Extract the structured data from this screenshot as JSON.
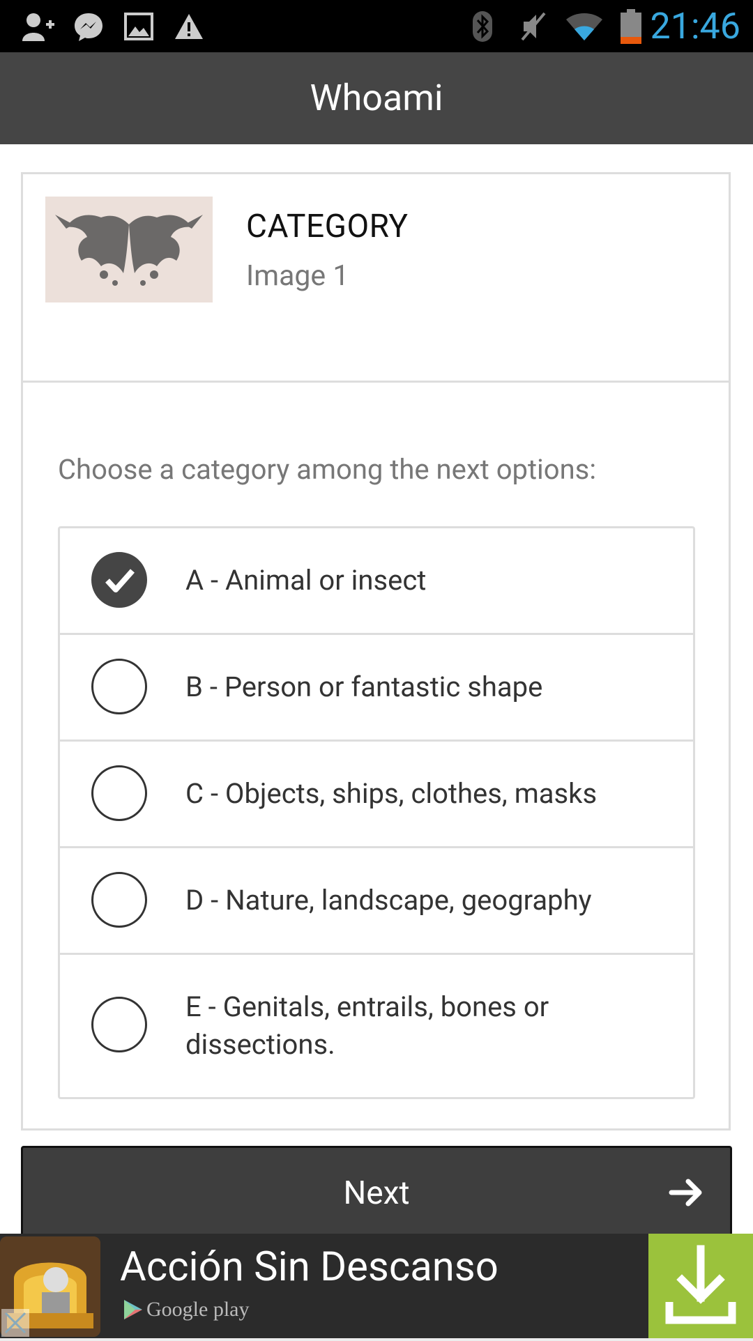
{
  "status_bar": {
    "time": "21:46",
    "icons": [
      "add-contact-icon",
      "messenger-icon",
      "gallery-icon",
      "warning-icon",
      "bluetooth-icon",
      "mute-icon",
      "wifi-icon",
      "battery-low-icon"
    ]
  },
  "app_bar": {
    "title": "Whoami"
  },
  "card": {
    "title": "CATEGORY",
    "subtitle": "Image 1",
    "prompt": "Choose a category among the next options:",
    "options": [
      {
        "label": "A - Animal or insect",
        "checked": true
      },
      {
        "label": "B - Person or fantastic shape",
        "checked": false
      },
      {
        "label": "C - Objects, ships, clothes, masks",
        "checked": false
      },
      {
        "label": "D - Nature, landscape, geography",
        "checked": false
      },
      {
        "label": "E - Genitals, entrails, bones or dissections.",
        "checked": false
      }
    ]
  },
  "next_button": {
    "label": "Next"
  },
  "ad": {
    "title": "Acción Sin Descanso",
    "store": "Google play"
  },
  "colors": {
    "app_bar": "#454545",
    "clock": "#39a8df",
    "download": "#9bc23c"
  }
}
